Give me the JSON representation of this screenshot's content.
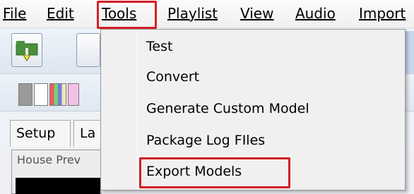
{
  "menubar": {
    "items": [
      {
        "label": "File"
      },
      {
        "label": "Edit"
      },
      {
        "label": "Tools"
      },
      {
        "label": "Playlist"
      },
      {
        "label": "View"
      },
      {
        "label": "Audio"
      },
      {
        "label": "Import"
      }
    ]
  },
  "tools_menu": {
    "items": [
      {
        "label": "Test"
      },
      {
        "label": "Convert"
      },
      {
        "label": "Generate Custom Model"
      },
      {
        "label": "Package Log FIles"
      },
      {
        "label": "Export Models"
      }
    ]
  },
  "tabs": [
    {
      "label": "Setup"
    },
    {
      "label": "La"
    }
  ],
  "house_preview": {
    "label": "House Prev"
  },
  "colors": {
    "highlight": "#d32027",
    "menu_bg": "#f0f0f0"
  },
  "icons": [
    "folder-play-icon",
    "toolbar-button-icon"
  ]
}
